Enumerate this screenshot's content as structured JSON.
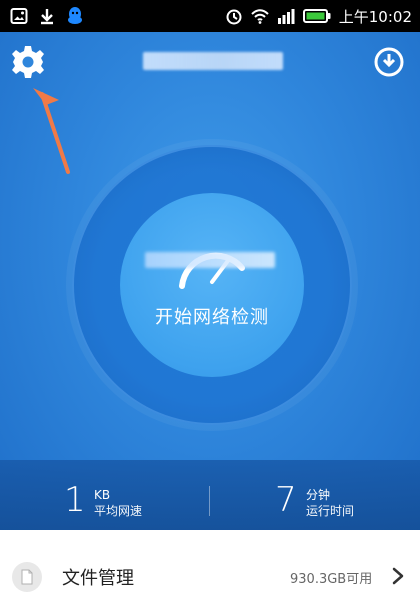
{
  "status_bar": {
    "time": "上午10:02",
    "icons": [
      "image-icon",
      "download-icon",
      "qq-icon",
      "alarm-icon",
      "wifi-icon",
      "signal-icon",
      "battery-icon"
    ]
  },
  "header": {
    "title": "",
    "icons": {
      "left": "gear-icon",
      "right": "power-icon"
    }
  },
  "main": {
    "start_test_label": "开始网络检测"
  },
  "stats": {
    "speed_value": "1",
    "speed_unit": "KB",
    "speed_label": "平均网速",
    "time_value": "7",
    "time_unit": "分钟",
    "time_label": "运行时间"
  },
  "file_manager": {
    "title": "文件管理",
    "free_space": "930.3GB可用"
  },
  "colors": {
    "status_bar_bg": "#000000",
    "primary_blue": "#2f86dc",
    "arrow": "#f07a47",
    "battery_green": "#3cc93c"
  }
}
